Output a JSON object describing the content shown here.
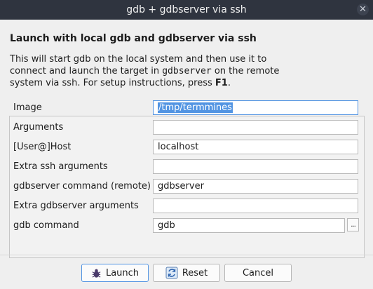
{
  "window": {
    "title": "gdb + gdbserver via ssh",
    "close_glyph": "✕"
  },
  "dialog": {
    "heading": "Launch with local gdb and gdbserver via ssh",
    "description": {
      "line1": "This will start gdb on the local system and then use it to",
      "line2_pre": "connect and launch the target in ",
      "line2_code": "gdbserver",
      "line2_post": " on the remote",
      "line3_pre": "system via ssh. For setup instructions, press ",
      "line3_key": "F1",
      "line3_post": "."
    }
  },
  "form": {
    "image": {
      "label": "Image",
      "value": "/tmp/termmines"
    },
    "arguments": {
      "label": "Arguments",
      "value": ""
    },
    "host": {
      "label": "[User@]Host",
      "value": "localhost"
    },
    "extra_ssh": {
      "label": "Extra ssh arguments",
      "value": ""
    },
    "gdbserver_cmd": {
      "label": "gdbserver command (remote)",
      "value": "gdbserver"
    },
    "extra_gdbserver": {
      "label": "Extra gdbserver arguments",
      "value": ""
    },
    "gdb_cmd": {
      "label": "gdb command",
      "value": "gdb",
      "browse_label": "..."
    }
  },
  "buttons": {
    "launch": "Launch",
    "reset": "Reset",
    "cancel": "Cancel"
  },
  "colors": {
    "accent": "#5294e2",
    "titlebar": "#2f343f"
  }
}
